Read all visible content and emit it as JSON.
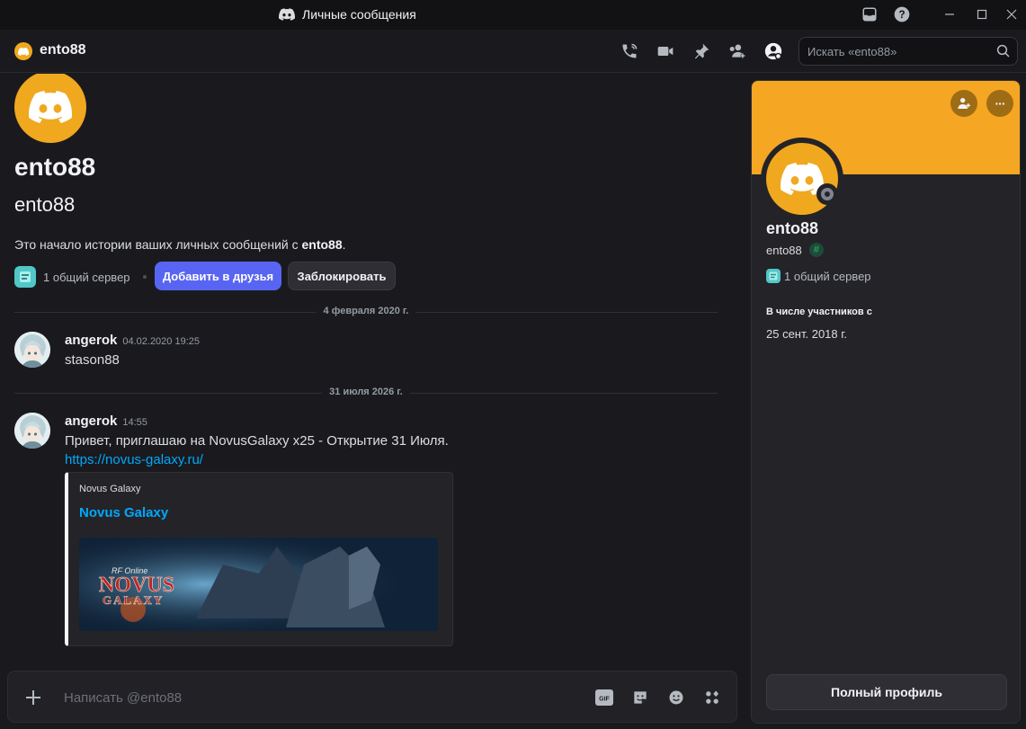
{
  "window": {
    "title": "Личные сообщения"
  },
  "header": {
    "dm_name": "ento88",
    "search_placeholder": "Искать «ento88»"
  },
  "intro": {
    "name": "ento88",
    "username": "ento88",
    "text_prefix": "Это начало истории ваших личных сообщений с ",
    "text_user": "ento88",
    "text_suffix": ".",
    "mutual_servers": "1 общий сервер",
    "add_friend_label": "Добавить в друзья",
    "block_label": "Заблокировать"
  },
  "dividers": [
    {
      "label": "4 февраля 2020 г."
    },
    {
      "label": "31 июля 2026 г."
    }
  ],
  "messages": [
    {
      "author": "angerok",
      "timestamp": "04.02.2020 19:25",
      "text": "stason88"
    },
    {
      "author": "angerok",
      "timestamp": "14:55",
      "text": "Привет, приглашаю на NovusGalaxy x25 - Открытие 31 Июля.",
      "link": "https://novus-galaxy.ru/",
      "embed": {
        "provider": "Novus Galaxy",
        "title": "Novus Galaxy",
        "image_logo_line1": "RF Online",
        "image_logo_line2": "NOVUS",
        "image_logo_line3": "GALAXY"
      }
    }
  ],
  "composer": {
    "placeholder": "Написать @ento88",
    "gif_label": "GIF"
  },
  "profile": {
    "name": "ento88",
    "username": "ento88",
    "mutual_servers": "1 общий сервер",
    "member_since_label": "В числе участников с",
    "member_since": "25 сент. 2018 г.",
    "full_profile_label": "Полный профиль",
    "more_label": "···"
  },
  "colors": {
    "accent_brand": "#5865f2",
    "avatar_orange": "#f0a81e",
    "banner_orange": "#f5a623",
    "link_blue": "#00a8fc"
  }
}
